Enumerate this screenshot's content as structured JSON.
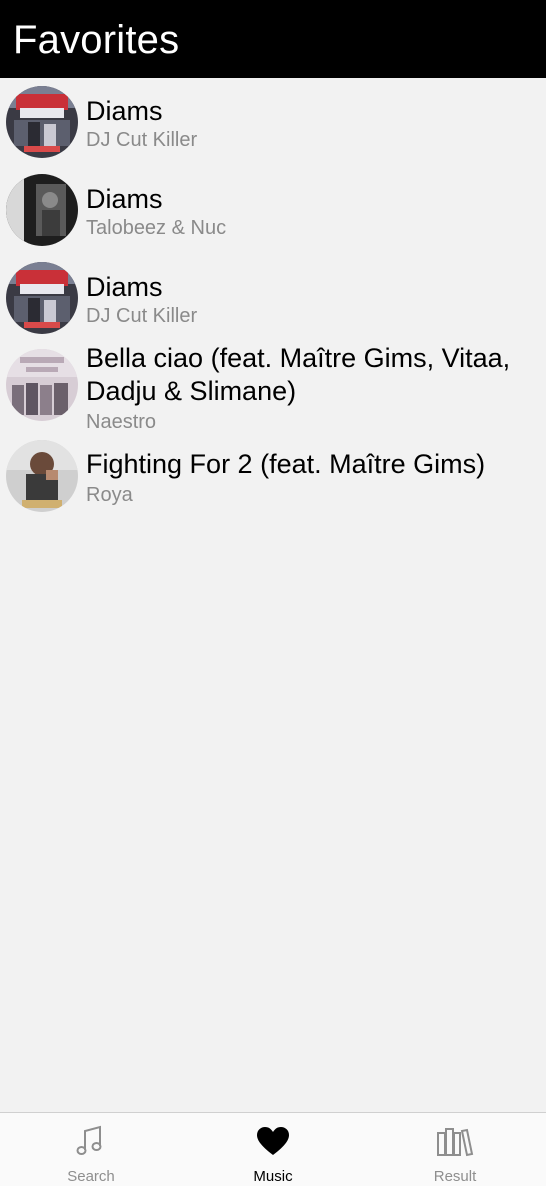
{
  "header": {
    "title": "Favorites"
  },
  "favorites": [
    {
      "title": "Diams",
      "artist": "DJ Cut Killer"
    },
    {
      "title": "Diams",
      "artist": "Talobeez & Nuc"
    },
    {
      "title": "Diams",
      "artist": "DJ Cut Killer"
    },
    {
      "title": "Bella ciao (feat. Maître Gims, Vitaa, Dadju & Slimane)",
      "artist": "Naestro"
    },
    {
      "title": "Fighting For 2 (feat. Maître Gims)",
      "artist": "Roya"
    }
  ],
  "tabbar": {
    "tabs": [
      {
        "label": "Search",
        "icon": "music-note-icon",
        "active": false
      },
      {
        "label": "Music",
        "icon": "heart-icon",
        "active": true
      },
      {
        "label": "Result",
        "icon": "library-icon",
        "active": false
      }
    ]
  },
  "colors": {
    "header_bg": "#000000",
    "active_tab": "#000000",
    "inactive_tab": "#8e8e8e",
    "subtitle": "#8a8a8a"
  }
}
